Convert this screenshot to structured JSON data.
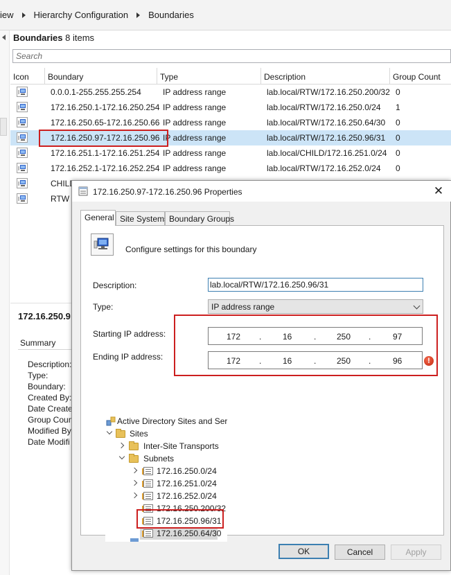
{
  "breadcrumb": {
    "items": [
      "iew",
      "Hierarchy Configuration",
      "Boundaries"
    ]
  },
  "list": {
    "title": "Boundaries",
    "count_text": "8 items",
    "search_placeholder": "Search",
    "columns": [
      "Icon",
      "Boundary",
      "Type",
      "Description",
      "Group Count"
    ],
    "rows": [
      {
        "boundary": "0.0.0.1-255.255.255.254",
        "type": "IP address range",
        "description": "lab.local/RTW/172.16.250.200/32",
        "group_count": "0"
      },
      {
        "boundary": "172.16.250.1-172.16.250.254",
        "type": "IP address range",
        "description": "lab.local/RTW/172.16.250.0/24",
        "group_count": "1"
      },
      {
        "boundary": "172.16.250.65-172.16.250.66",
        "type": "IP address range",
        "description": "lab.local/RTW/172.16.250.64/30",
        "group_count": "0"
      },
      {
        "boundary": "172.16.250.97-172.16.250.96",
        "type": "IP address range",
        "description": "lab.local/RTW/172.16.250.96/31",
        "group_count": "0"
      },
      {
        "boundary": "172.16.251.1-172.16.251.254",
        "type": "IP address range",
        "description": "lab.local/CHILD/172.16.251.0/24",
        "group_count": "0"
      },
      {
        "boundary": "172.16.252.1-172.16.252.254",
        "type": "IP address range",
        "description": "lab.local/RTW/172.16.252.0/24",
        "group_count": "0"
      },
      {
        "boundary": "CHILD",
        "type": "",
        "description": "",
        "group_count": ""
      },
      {
        "boundary": "RTW",
        "type": "",
        "description": "",
        "group_count": ""
      }
    ]
  },
  "details": {
    "title": "172.16.250.9",
    "summary_label": "Summary",
    "fields": [
      "Description:",
      "Type:",
      "Boundary:",
      "Created By:",
      "Date Create",
      "Group Coun",
      "Modified By",
      "Date Modifi"
    ]
  },
  "dialog": {
    "title": "172.16.250.97-172.16.250.96 Properties",
    "close_glyph": "✕",
    "tabs": [
      "General",
      "Site Systems",
      "Boundary Groups"
    ],
    "header_text": "Configure settings for this boundary",
    "description_label": "Description:",
    "description_value": "lab.local/RTW/172.16.250.96/31",
    "type_label": "Type:",
    "type_value": "IP address range",
    "start_label": "Starting IP address:",
    "end_label": "Ending IP address:",
    "start_ip": [
      "172",
      "16",
      "250",
      "97"
    ],
    "end_ip": [
      "172",
      "16",
      "250",
      "96"
    ],
    "error_glyph": "!",
    "buttons": {
      "ok": "OK",
      "cancel": "Cancel",
      "apply": "Apply"
    }
  },
  "ad_tree": {
    "root": "Active Directory Sites and Serv",
    "sites": "Sites",
    "inter_site": "Inter-Site Transports",
    "subnets": "Subnets",
    "subnet_items": [
      "172.16.250.0/24",
      "172.16.251.0/24",
      "172.16.252.0/24",
      "172.16.250.200/32",
      "172.16.250.96/31",
      "172.16.250.64/30"
    ]
  },
  "colors": {
    "selection": "#cce4f7",
    "annotation_red": "#cc1f1f",
    "focus_blue": "#3c7fb1"
  }
}
